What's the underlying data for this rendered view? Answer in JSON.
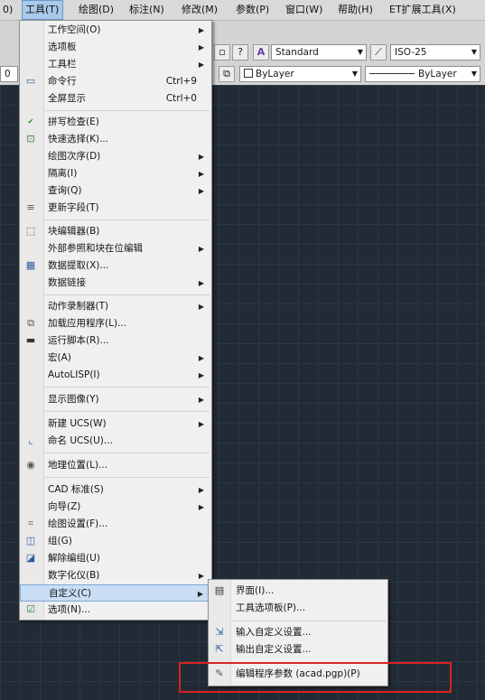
{
  "menubar": {
    "items": [
      {
        "label": "0)"
      },
      {
        "label": "工具(T)"
      },
      {
        "label": "绘图(D)"
      },
      {
        "label": "标注(N)"
      },
      {
        "label": "修改(M)"
      },
      {
        "label": "参数(P)"
      },
      {
        "label": "窗口(W)"
      },
      {
        "label": "帮助(H)"
      },
      {
        "label": "ET扩展工具(X)"
      }
    ]
  },
  "toolbar": {
    "help_btn": "?",
    "text_style_icon": "A",
    "text_style": "Standard",
    "dim_style": "ISO-25",
    "layer_left_fragment": "0",
    "color_value": "ByLayer",
    "linetype_value": "ByLayer"
  },
  "tools_menu": {
    "items": [
      {
        "label": "工作空间(O)",
        "submenu": true
      },
      {
        "label": "选项板",
        "submenu": true
      },
      {
        "label": "工具栏",
        "submenu": true
      },
      {
        "label": "命令行",
        "shortcut": "Ctrl+9",
        "icon": "command-line-icon"
      },
      {
        "label": "全屏显示",
        "shortcut": "Ctrl+0"
      },
      {
        "label": "拼写检查(E)",
        "icon": "spell-check-icon"
      },
      {
        "label": "快速选择(K)...",
        "icon": "quick-select-icon"
      },
      {
        "label": "绘图次序(D)",
        "submenu": true
      },
      {
        "label": "隔离(I)",
        "submenu": true
      },
      {
        "label": "查询(Q)",
        "submenu": true
      },
      {
        "label": "更新字段(T)",
        "icon": "update-field-icon"
      },
      {
        "label": "块编辑器(B)",
        "icon": "block-editor-icon"
      },
      {
        "label": "外部参照和块在位编辑",
        "submenu": true
      },
      {
        "label": "数据提取(X)...",
        "icon": "data-extraction-icon"
      },
      {
        "label": "数据链接",
        "submenu": true
      },
      {
        "label": "动作录制器(T)",
        "submenu": true
      },
      {
        "label": "加载应用程序(L)...",
        "icon": "load-application-icon"
      },
      {
        "label": "运行脚本(R)...",
        "icon": "run-script-icon"
      },
      {
        "label": "宏(A)",
        "submenu": true
      },
      {
        "label": "AutoLISP(I)",
        "submenu": true
      },
      {
        "label": "显示图像(Y)",
        "submenu": true
      },
      {
        "label": "新建 UCS(W)",
        "submenu": true
      },
      {
        "label": "命名 UCS(U)...",
        "icon": "named-ucs-icon"
      },
      {
        "label": "地理位置(L)...",
        "icon": "geolocation-icon"
      },
      {
        "label": "CAD 标准(S)",
        "submenu": true
      },
      {
        "label": "向导(Z)",
        "submenu": true
      },
      {
        "label": "绘图设置(F)...",
        "icon": "drafting-settings-icon"
      },
      {
        "label": "组(G)",
        "icon": "group-icon"
      },
      {
        "label": "解除编组(U)",
        "icon": "ungroup-icon"
      },
      {
        "label": "数字化仪(B)",
        "submenu": true
      },
      {
        "label": "自定义(C)",
        "submenu": true
      },
      {
        "label": "选项(N)...",
        "icon": "options-icon"
      }
    ]
  },
  "customize_submenu": {
    "items": [
      {
        "label": "界面(I)...",
        "icon": "interface-icon"
      },
      {
        "label": "工具选项板(P)..."
      },
      {
        "label": "输入自定义设置...",
        "icon": "import-customization-icon"
      },
      {
        "label": "输出自定义设置...",
        "icon": "export-customization-icon"
      },
      {
        "label": "编辑程序参数 (acad.pgp)(P)",
        "icon": "edit-pgp-icon"
      }
    ]
  },
  "colors": {
    "accent_highlight": "#c9def5",
    "annotation_box": "#d92323",
    "canvas": "#222b35"
  }
}
